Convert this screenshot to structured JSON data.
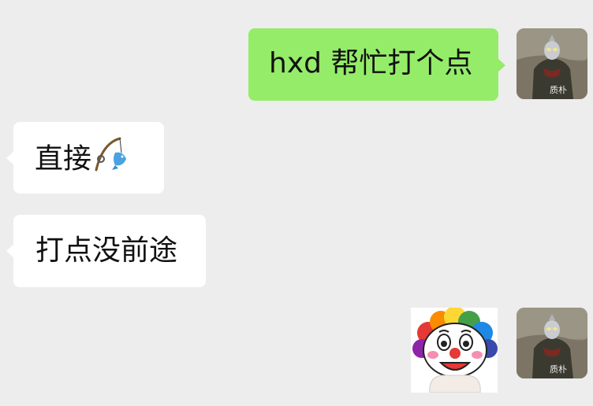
{
  "messages": [
    {
      "id": "m1",
      "side": "out",
      "text": "hxd 帮忙打个点"
    },
    {
      "id": "m2",
      "side": "in",
      "text": "直接",
      "emoji": "fishing-pole-and-fish-icon"
    },
    {
      "id": "m3",
      "side": "in",
      "text": "打点没前途"
    },
    {
      "id": "m4",
      "side": "out",
      "sticker": "clown-face-sticker"
    }
  ],
  "self_avatar": {
    "watermark": "质朴",
    "icon": "ultraman-avatar"
  },
  "colors": {
    "background": "#ededed",
    "outgoing_bubble": "#95ec69",
    "incoming_bubble": "#ffffff"
  }
}
